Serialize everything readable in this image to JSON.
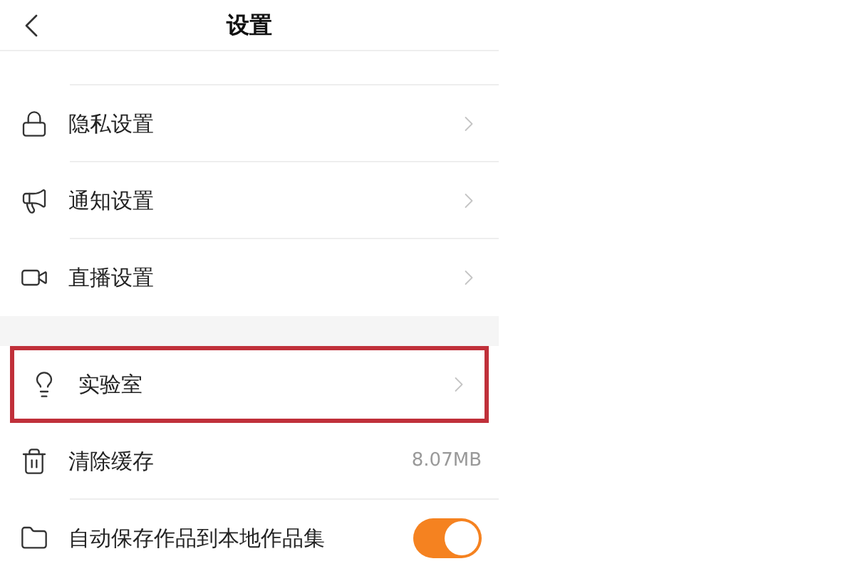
{
  "header": {
    "title": "设置"
  },
  "groups": [
    {
      "items": [
        {
          "label": "隐私设置",
          "kind": "chevron",
          "highlighted": false
        },
        {
          "label": "通知设置",
          "kind": "chevron",
          "highlighted": false
        },
        {
          "label": "直播设置",
          "kind": "chevron",
          "highlighted": false
        }
      ]
    },
    {
      "items": [
        {
          "label": "实验室",
          "kind": "chevron",
          "highlighted": true
        },
        {
          "label": "清除缓存",
          "kind": "value",
          "value": "8.07MB",
          "highlighted": false
        },
        {
          "label": "自动保存作品到本地作品集",
          "kind": "toggle",
          "on": true,
          "highlighted": false
        }
      ]
    }
  ]
}
